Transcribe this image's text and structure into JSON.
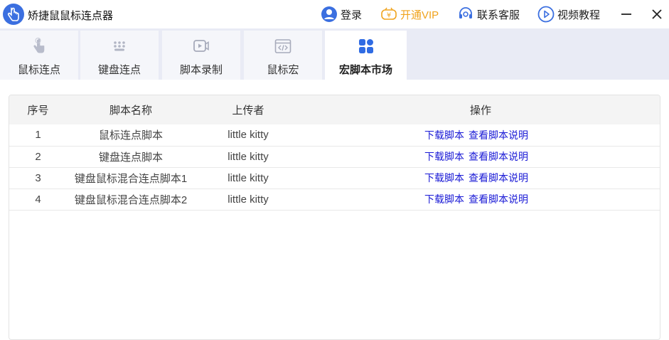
{
  "app": {
    "title": "矫捷鼠鼠标连点器"
  },
  "toolbar": {
    "login": "登录",
    "vip": "开通VIP",
    "service": "联系客服",
    "video": "视频教程"
  },
  "colors": {
    "accent": "#3b6fe0",
    "vip": "#f0a31c",
    "link": "#1a1ad6"
  },
  "tabs": [
    {
      "label": "鼠标连点",
      "icon": "hand-pointer-icon"
    },
    {
      "label": "键盘连点",
      "icon": "keyboard-dots-icon"
    },
    {
      "label": "脚本录制",
      "icon": "record-video-icon"
    },
    {
      "label": "鼠标宏",
      "icon": "code-window-icon"
    },
    {
      "label": "宏脚本市场",
      "icon": "grid-apps-icon",
      "active": true
    }
  ],
  "table": {
    "headers": {
      "no": "序号",
      "name": "脚本名称",
      "uploader": "上传者",
      "ops": "操作"
    },
    "download_label": "下载脚本",
    "readme_label": "查看脚本说明",
    "rows": [
      {
        "no": "1",
        "name": "鼠标连点脚本",
        "uploader": "little kitty"
      },
      {
        "no": "2",
        "name": "键盘连点脚本",
        "uploader": "little kitty"
      },
      {
        "no": "3",
        "name": "键盘鼠标混合连点脚本1",
        "uploader": "little kitty"
      },
      {
        "no": "4",
        "name": "键盘鼠标混合连点脚本2",
        "uploader": "little kitty"
      }
    ]
  }
}
